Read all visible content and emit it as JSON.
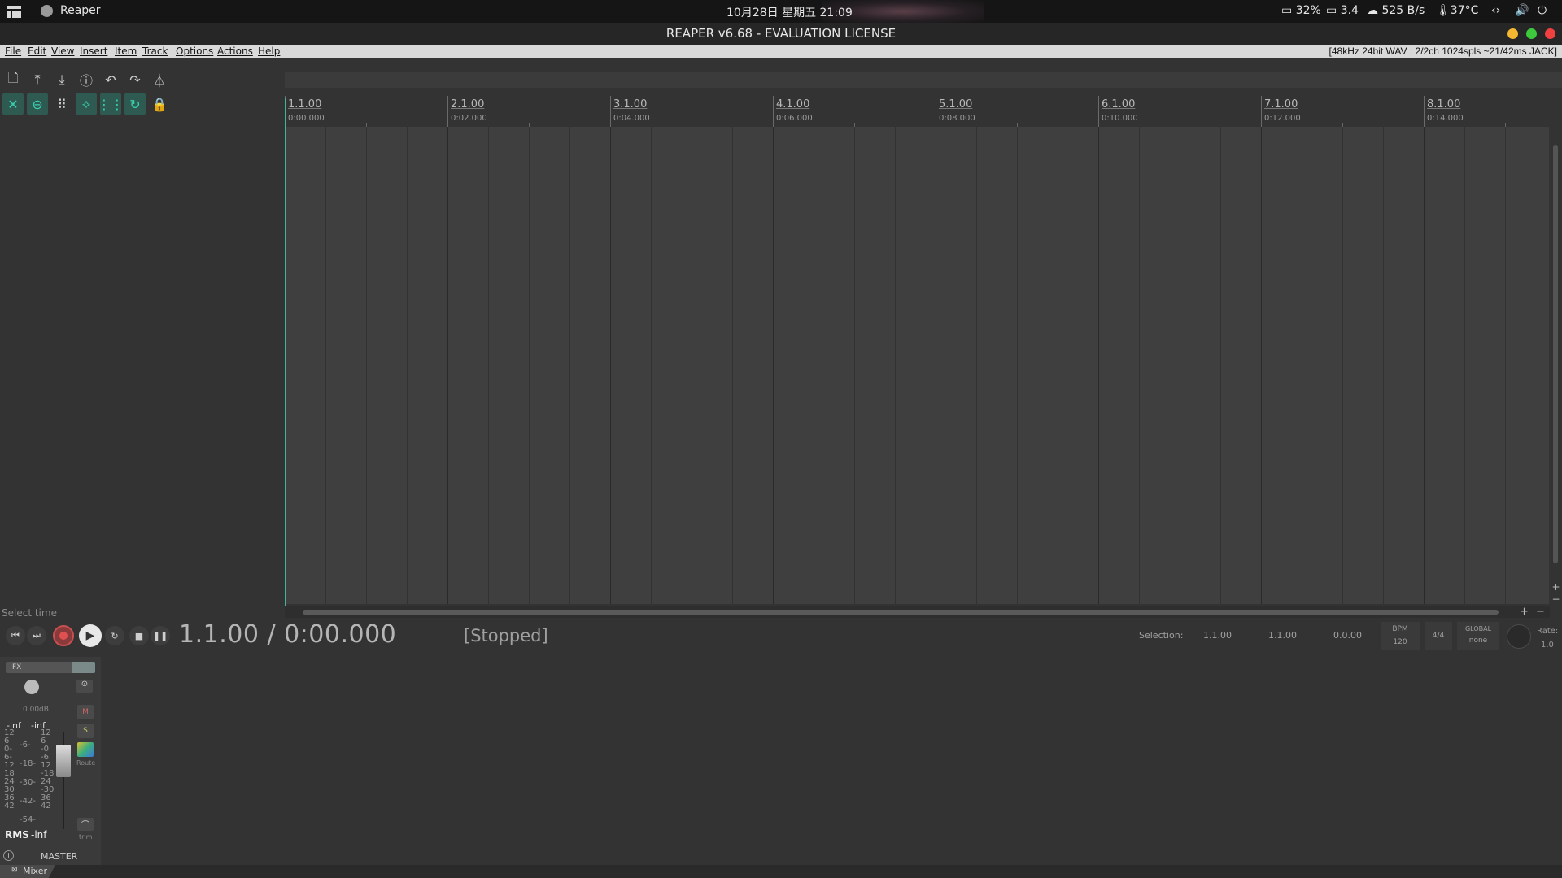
{
  "system_bar": {
    "app_name": "Reaper",
    "clock": "10月28日 星期五  21:09",
    "battery": "32%",
    "load": "3.4",
    "network": "525 B/s",
    "temperature": "37°C"
  },
  "window": {
    "title": "REAPER v6.68 - EVALUATION LICENSE",
    "buttons": {
      "minimize_color": "#f5b731",
      "maximize_color": "#3cc93c",
      "close_color": "#f04040"
    }
  },
  "menu": {
    "items": [
      "File",
      "Edit",
      "View",
      "Insert",
      "Item",
      "Track",
      "Options",
      "Actions",
      "Help"
    ],
    "status": "[48kHz 24bit WAV : 2/2ch 1024spls ~21/42ms JACK]"
  },
  "toolbar": {
    "row1": [
      "new-project-icon",
      "open-project-icon",
      "save-project-icon",
      "project-settings-icon",
      "undo-icon",
      "redo-icon",
      "metronome-icon"
    ],
    "row2": [
      "auto-crossfade-icon",
      "ripple-link-icon",
      "grid-icon",
      "snap-icon",
      "item-grouping-icon",
      "loop-icon",
      "lock-icon"
    ],
    "accent": "#39d0b0"
  },
  "ruler": {
    "markers": [
      {
        "measure": "1.1.00",
        "time": "0:00.000"
      },
      {
        "measure": "2.1.00",
        "time": "0:02.000"
      },
      {
        "measure": "3.1.00",
        "time": "0:04.000"
      },
      {
        "measure": "4.1.00",
        "time": "0:06.000"
      },
      {
        "measure": "5.1.00",
        "time": "0:08.000"
      },
      {
        "measure": "6.1.00",
        "time": "0:10.000"
      },
      {
        "measure": "7.1.00",
        "time": "0:12.000"
      },
      {
        "measure": "8.1.00",
        "time": "0:14.000"
      }
    ]
  },
  "transport": {
    "select_time": "Select time",
    "position": "1.1.00 / 0:00.000",
    "state": "[Stopped]",
    "selection_label": "Selection:",
    "selection_start": "1.1.00",
    "selection_end": "1.1.00",
    "selection_length": "0.0.00",
    "bpm_label": "BPM",
    "bpm": "120",
    "time_signature": "4/4",
    "global_label": "GLOBAL",
    "global_value": "none",
    "rate_label": "Rate:",
    "rate": "1.0"
  },
  "master": {
    "fx_label": "FX",
    "volume": "0.00dB",
    "peak_left": "-inf",
    "peak_right": "-inf",
    "mute": "M",
    "solo": "S",
    "route": "Route",
    "trim": "trim",
    "rms_label": "RMS",
    "rms_value": "-inf",
    "name": "MASTER",
    "scale_outer": [
      "12",
      "6",
      "0-",
      "6-",
      "12",
      "18",
      "24",
      "30",
      "36",
      "42"
    ],
    "scale_inner": [
      "-6-",
      "-18-",
      "-30-",
      "-42-",
      "-54-"
    ],
    "scale_right": [
      "12",
      "6",
      "-0",
      "-6",
      "12",
      "-18",
      "24",
      "-30",
      "36",
      "42"
    ]
  },
  "mixer_tab": {
    "label": "Mixer"
  }
}
